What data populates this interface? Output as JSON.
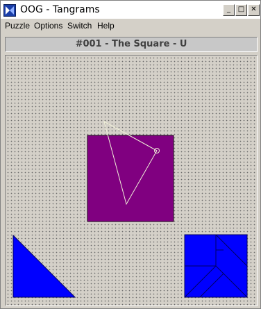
{
  "window": {
    "title": "OOG - Tangrams",
    "minimize_glyph": "_",
    "maximize_glyph": "□",
    "close_glyph": "✕"
  },
  "menu": [
    {
      "label": "Puzzle"
    },
    {
      "label": "Options"
    },
    {
      "label": "Switch"
    },
    {
      "label": "Help"
    }
  ],
  "puzzle": {
    "title": "#001 - The Square - U"
  },
  "colors": {
    "target_square": "#800080",
    "piece_fill": "#0000ff",
    "piece_outline": "#000080",
    "outline_stroke": "#f0f0d8"
  }
}
